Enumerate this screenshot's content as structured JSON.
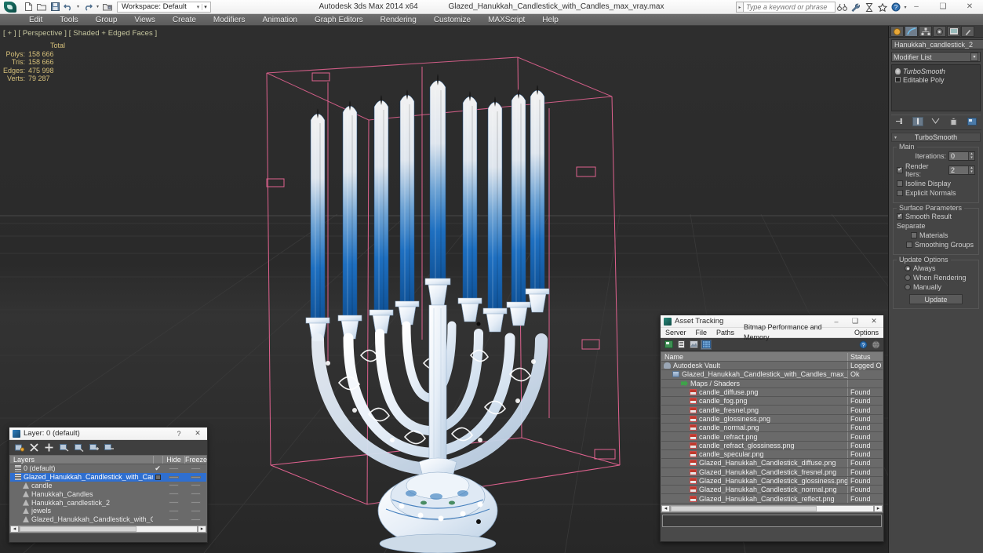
{
  "titlebar": {
    "app_title": "Autodesk 3ds Max  2014 x64",
    "file_title": "Glazed_Hanukkah_Candlestick_with_Candles_max_vray.max",
    "workspace_label": "Workspace: Default",
    "minimize": "–",
    "maximize": "❑",
    "close": "✕"
  },
  "search": {
    "placeholder": "Type a keyword or phrase",
    "value": ""
  },
  "menubar": {
    "items": [
      "Edit",
      "Tools",
      "Group",
      "Views",
      "Create",
      "Modifiers",
      "Animation",
      "Graph Editors",
      "Rendering",
      "Customize",
      "MAXScript",
      "Help"
    ]
  },
  "viewport": {
    "label": "[ + ] [ Perspective ] [ Shaded + Edged Faces ]",
    "stats_header": "Total",
    "stats": [
      {
        "label": "Polys:",
        "value": "158 666"
      },
      {
        "label": "Tris:",
        "value": "158 666"
      },
      {
        "label": "Edges:",
        "value": "475 998"
      },
      {
        "label": "Verts:",
        "value": "79 287"
      }
    ]
  },
  "command_panel": {
    "object_name": "Hanukkah_candlestick_2",
    "modifier_list_label": "Modifier List",
    "stack": [
      {
        "label": "TurboSmooth",
        "italic": true
      },
      {
        "label": "Editable Poly",
        "italic": false
      }
    ],
    "rollout": {
      "title": "TurboSmooth",
      "main_group": "Main",
      "iterations_label": "Iterations:",
      "iterations_value": "0",
      "render_iters_label": "Render Iters:",
      "render_iters_value": "2",
      "render_iters_checked": true,
      "isoline_display": "Isoline Display",
      "explicit_normals": "Explicit Normals",
      "surface_group": "Surface Parameters",
      "smooth_result": "Smooth Result",
      "separate_label": "Separate",
      "materials": "Materials",
      "smoothing_groups": "Smoothing Groups",
      "update_group": "Update Options",
      "always": "Always",
      "when_rendering": "When Rendering",
      "manually": "Manually",
      "update_button": "Update"
    }
  },
  "asset_tracking": {
    "title": "Asset Tracking",
    "menus": [
      "Server",
      "File",
      "Paths",
      "Bitmap Performance and Memory",
      "Options"
    ],
    "columns": {
      "name": "Name",
      "status": "Status"
    },
    "rows": [
      {
        "name": "Autodesk Vault",
        "status": "Logged O",
        "icon": "vault-icon",
        "indent": 0
      },
      {
        "name": "Glazed_Hanukkah_Candlestick_with_Candles_max_vray.max",
        "status": "Ok",
        "icon": "max-file-icon",
        "indent": 1
      },
      {
        "name": "Maps / Shaders",
        "status": "",
        "icon": "maps-icon",
        "indent": 2
      },
      {
        "name": "candle_diffuse.png",
        "status": "Found",
        "icon": "png-icon",
        "indent": 3
      },
      {
        "name": "candle_fog.png",
        "status": "Found",
        "icon": "png-icon",
        "indent": 3
      },
      {
        "name": "candle_fresnel.png",
        "status": "Found",
        "icon": "png-icon",
        "indent": 3
      },
      {
        "name": "candle_glossiness.png",
        "status": "Found",
        "icon": "png-icon",
        "indent": 3
      },
      {
        "name": "candle_normal.png",
        "status": "Found",
        "icon": "png-icon",
        "indent": 3
      },
      {
        "name": "candle_refract.png",
        "status": "Found",
        "icon": "png-icon",
        "indent": 3
      },
      {
        "name": "candle_refract_glossiness.png",
        "status": "Found",
        "icon": "png-icon",
        "indent": 3
      },
      {
        "name": "candle_specular.png",
        "status": "Found",
        "icon": "png-icon",
        "indent": 3
      },
      {
        "name": "Glazed_Hanukkah_Candlestick_diffuse.png",
        "status": "Found",
        "icon": "png-icon",
        "indent": 3
      },
      {
        "name": "Glazed_Hanukkah_Candlestick_fresnel.png",
        "status": "Found",
        "icon": "png-icon",
        "indent": 3
      },
      {
        "name": "Glazed_Hanukkah_Candlestick_glossiness.png",
        "status": "Found",
        "icon": "png-icon",
        "indent": 3
      },
      {
        "name": "Glazed_Hanukkah_Candlestick_normal.png",
        "status": "Found",
        "icon": "png-icon",
        "indent": 3
      },
      {
        "name": "Glazed_Hanukkah_Candlestick_reflect.png",
        "status": "Found",
        "icon": "png-icon",
        "indent": 3
      }
    ]
  },
  "layer_dialog": {
    "title": "Layer: 0 (default)",
    "help": "?",
    "close": "✕",
    "columns": {
      "layers": "Layers",
      "hide": "Hide",
      "freeze": "Freeze"
    },
    "rows": [
      {
        "name": "0 (default)",
        "type": "layer",
        "selected": false,
        "indent": 0,
        "checked": true
      },
      {
        "name": "Glazed_Hanukkah_Candlestick_with_Candles",
        "type": "layer",
        "selected": true,
        "indent": 0,
        "checked": false
      },
      {
        "name": "candle",
        "type": "object",
        "selected": false,
        "indent": 1,
        "checked": false
      },
      {
        "name": "Hanukkah_Candles",
        "type": "object",
        "selected": false,
        "indent": 1,
        "checked": false
      },
      {
        "name": "Hanukkah_candlestick_2",
        "type": "object",
        "selected": false,
        "indent": 1,
        "checked": false
      },
      {
        "name": "jewels",
        "type": "object",
        "selected": false,
        "indent": 1,
        "checked": false
      },
      {
        "name": "Glazed_Hanukkah_Candlestick_with_Candles",
        "type": "object",
        "selected": false,
        "indent": 1,
        "checked": false
      }
    ]
  },
  "colors": {
    "candle_blue": "#1b6fc0",
    "accent_gold": "#d6c07a",
    "selection_blue": "#2f6fd0",
    "viewport_bg": "#2b2b2b",
    "helper_pink": "#e85f8f"
  }
}
